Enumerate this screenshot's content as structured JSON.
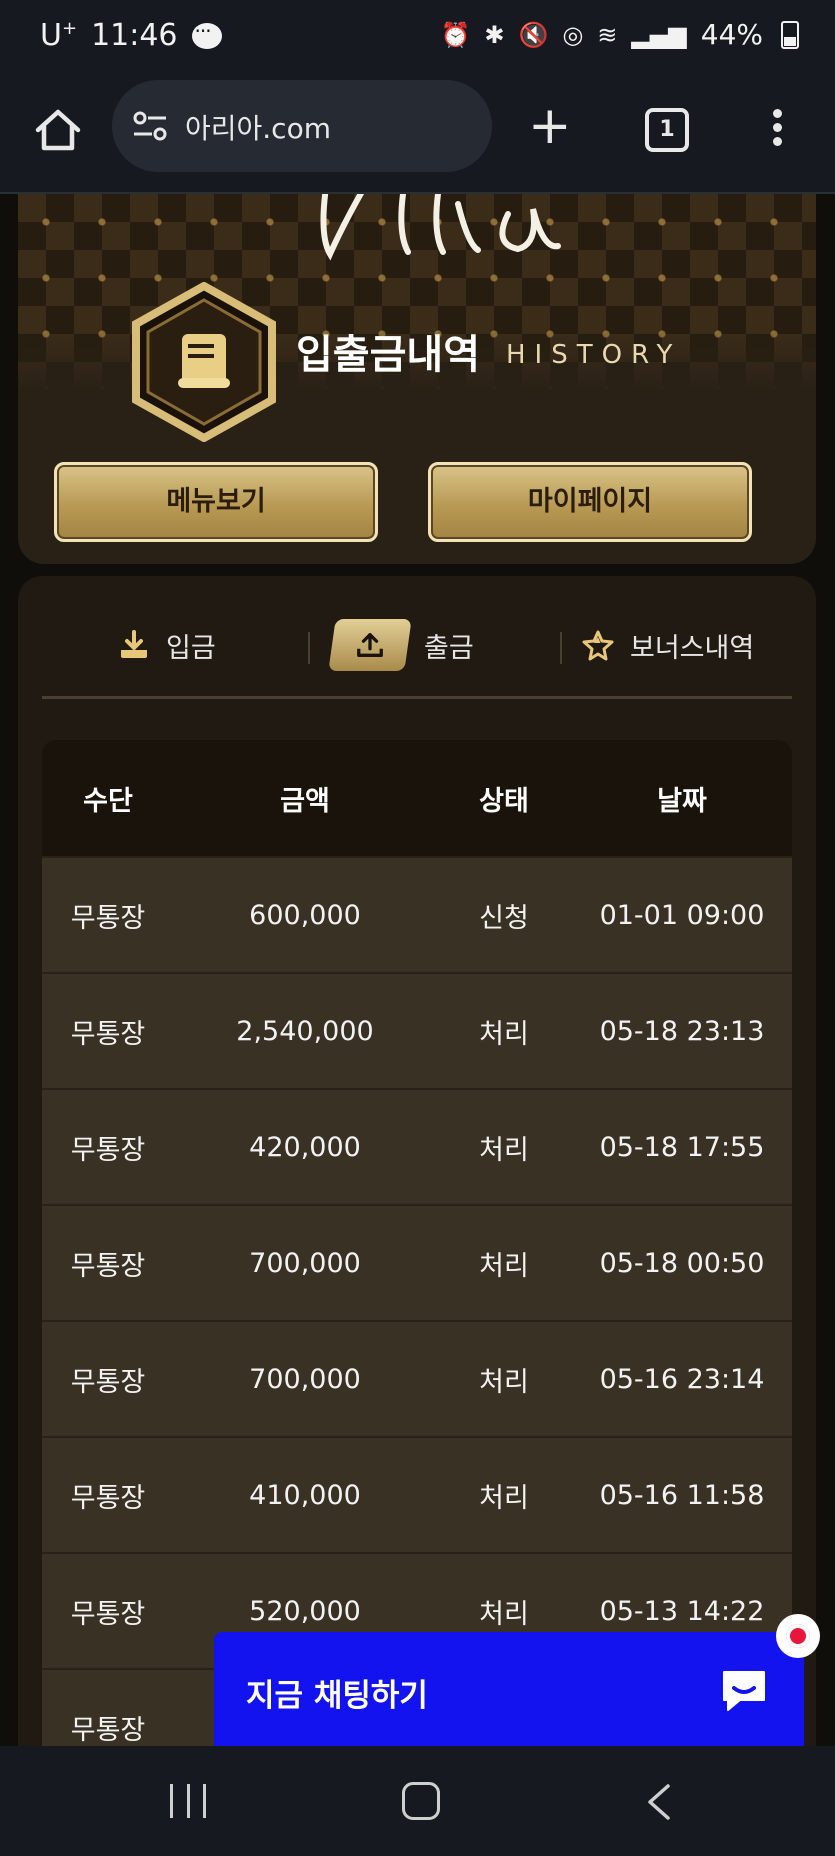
{
  "status_bar": {
    "carrier": "U",
    "carrier_sup": "+",
    "time": "11:46",
    "battery": "44%"
  },
  "browser": {
    "url": "아리아.com",
    "tab_count": "1"
  },
  "hero": {
    "title": "입출금내역",
    "subtitle": "HISTORY",
    "menu_button": "메뉴보기",
    "mypage_button": "마이페이지"
  },
  "tabs": {
    "deposit": "입금",
    "withdraw": "출금",
    "bonus": "보너스내역",
    "active": "withdraw"
  },
  "table": {
    "headers": [
      "수단",
      "금액",
      "상태",
      "날짜"
    ],
    "rows": [
      [
        "무통장",
        "600,000",
        "신청",
        "01-01 09:00"
      ],
      [
        "무통장",
        "2,540,000",
        "처리",
        "05-18 23:13"
      ],
      [
        "무통장",
        "420,000",
        "처리",
        "05-18 17:55"
      ],
      [
        "무통장",
        "700,000",
        "처리",
        "05-18 00:50"
      ],
      [
        "무통장",
        "700,000",
        "처리",
        "05-16 23:14"
      ],
      [
        "무통장",
        "410,000",
        "처리",
        "05-16 11:58"
      ],
      [
        "무통장",
        "520,000",
        "처리",
        "05-13 14:22"
      ],
      [
        "무통장",
        "",
        "",
        ""
      ]
    ]
  },
  "chat": {
    "label": "지금 채팅하기"
  },
  "colors": {
    "gold": "#c8ad6a",
    "chat_blue": "#1313f0",
    "row_bg": "#3a3125",
    "header_bg": "#1a130b"
  }
}
